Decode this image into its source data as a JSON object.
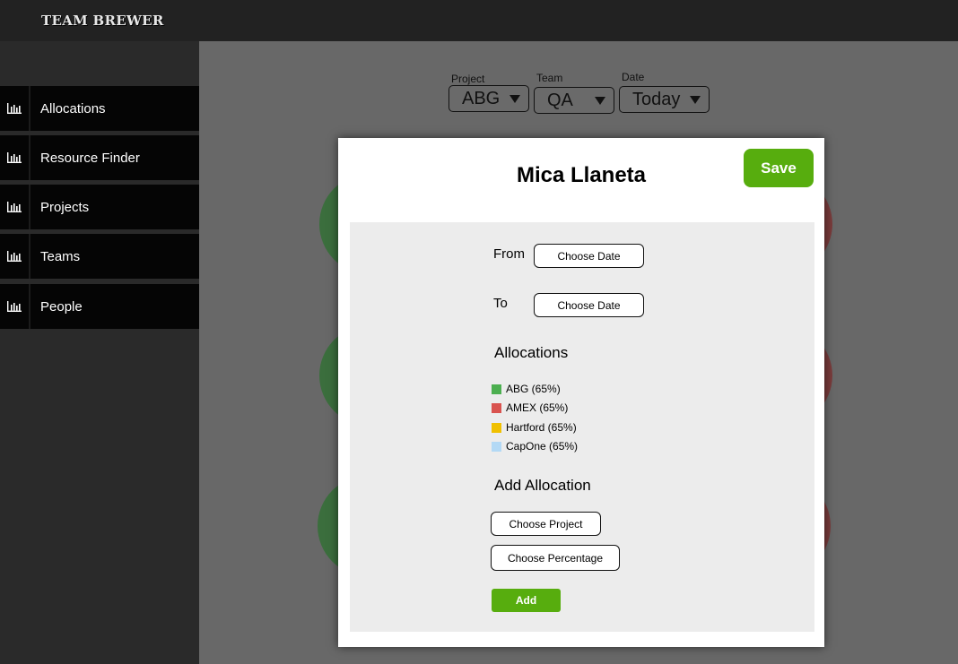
{
  "app": {
    "brand": "TEAM BREWER"
  },
  "sidebar": {
    "items": [
      {
        "label": "Allocations",
        "icon": "bar-chart-icon"
      },
      {
        "label": "Resource Finder",
        "icon": "bar-chart-icon"
      },
      {
        "label": "Projects",
        "icon": "bar-chart-icon"
      },
      {
        "label": "Teams",
        "icon": "bar-chart-icon"
      },
      {
        "label": "People",
        "icon": "bar-chart-icon"
      }
    ]
  },
  "filters": {
    "project": {
      "label": "Project",
      "value": "ABG"
    },
    "team": {
      "label": "Team",
      "value": "QA"
    },
    "date": {
      "label": "Date",
      "value": "Today"
    }
  },
  "modal": {
    "title": "Mica Llaneta",
    "save_label": "Save",
    "from_label": "From",
    "from_value": "Choose Date",
    "to_label": "To",
    "to_value": "Choose Date",
    "allocations_heading": "Allocations",
    "allocations": [
      {
        "name": "ABG (65%)",
        "color": "#4caf50"
      },
      {
        "name": "AMEX (65%)",
        "color": "#d9534f"
      },
      {
        "name": "Hartford (65%)",
        "color": "#f0c000"
      },
      {
        "name": "CapOne (65%)",
        "color": "#b3d9f5"
      }
    ],
    "add_heading": "Add Allocation",
    "choose_project": "Choose Project",
    "choose_percentage": "Choose Percentage",
    "add_label": "Add"
  },
  "colors": {
    "accent": "#57ad0e",
    "bubble_green": "#3b6e3d",
    "bubble_red": "#7a3c3c"
  }
}
